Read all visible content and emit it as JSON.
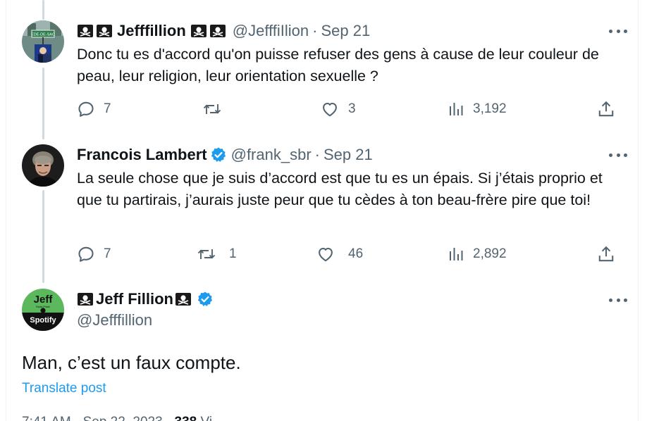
{
  "tweets": [
    {
      "name": "Jefffillion",
      "handle": "@JefffiIlion",
      "separator": "·",
      "date": "Sep 21",
      "text": "Donc tu es d'accord qu'on puisse refuser des gens à cause de leur couleur de peau, leur religion, leur orientation sexuelle ?",
      "replies": "7",
      "retweets": "",
      "likes": "3",
      "views": "3,192",
      "avatar_sign": "EDE-DE-SAC"
    },
    {
      "name": "Francois Lambert",
      "handle": "@frank_sbr",
      "separator": "·",
      "date": "Sep 21",
      "text": "La seule chose que je suis d’accord est que tu es un épais. Si j’étais proprio et que tu partirais, j’aurais juste peur que tu cèdes à ton beau-frère pire que toi!",
      "replies": "7",
      "retweets": "1",
      "likes": "46",
      "views": "2,892"
    }
  ],
  "main_tweet": {
    "name": "Jeff Fillion",
    "handle": "@Jefffillion",
    "text": "Man, c’est un faux compte.",
    "translate_label": "Translate post",
    "timestamp_partial": "7:41 AM · Sep 22, 2023 · ",
    "views_partial": "338",
    "views_suffix_partial": " Vi",
    "avatar_top": "Jeff",
    "avatar_small": "Radio      Pirate",
    "avatar_bottom": "Spotify"
  },
  "icons": [
    "pirate-flag-icon",
    "verified-icon",
    "reply-icon",
    "retweet-icon",
    "like-icon",
    "views-icon",
    "share-icon",
    "more-icon"
  ],
  "colors": {
    "accent": "#1d9bf0",
    "muted": "#536471",
    "text": "#0f1419",
    "thread_line": "#cfd9de",
    "spotify_green": "#5cb85c"
  }
}
